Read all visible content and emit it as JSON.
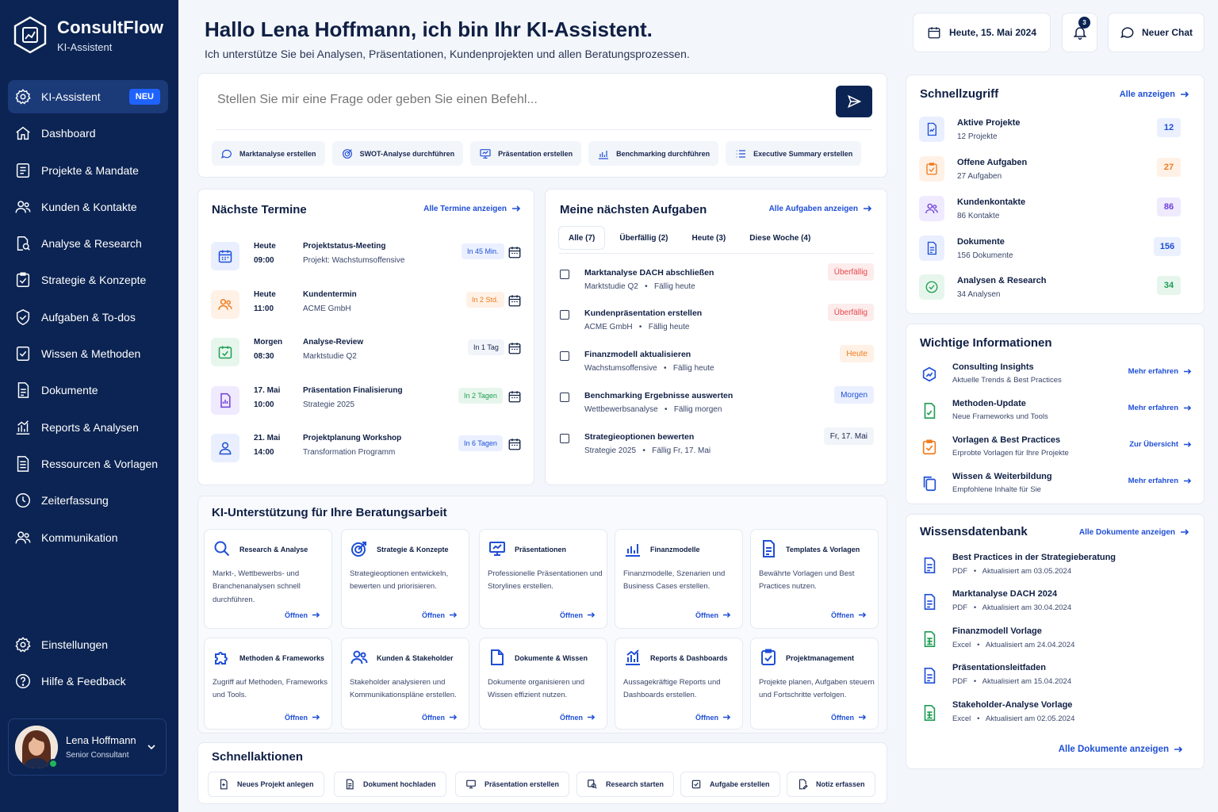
{
  "brand": {
    "name": "ConsultFlow",
    "subtitle": "KI-Assistent"
  },
  "nav": {
    "items": [
      {
        "label": "KI-Assistent",
        "badge": "NEU",
        "icon": "gear-icon"
      },
      {
        "label": "Dashboard",
        "icon": "home-icon"
      },
      {
        "label": "Projekte & Mandate",
        "icon": "folder-icon"
      },
      {
        "label": "Kunden & Kontakte",
        "icon": "users-icon"
      },
      {
        "label": "Analyse & Research",
        "icon": "search-icon"
      },
      {
        "label": "Strategie & Konzepte",
        "icon": "checklist-icon"
      },
      {
        "label": "Aufgaben & To-dos",
        "icon": "task-icon"
      },
      {
        "label": "Wissen & Methoden",
        "icon": "book-icon"
      },
      {
        "label": "Dokumente",
        "icon": "document-icon"
      },
      {
        "label": "Reports & Analysen",
        "icon": "chart-icon"
      },
      {
        "label": "Ressourcen & Vorlagen",
        "icon": "template-icon"
      },
      {
        "label": "Zeiterfassung",
        "icon": "clock-icon"
      },
      {
        "label": "Kommunikation",
        "icon": "chat-icon"
      }
    ],
    "bottom": [
      {
        "label": "Einstellungen",
        "icon": "gear-icon"
      },
      {
        "label": "Hilfe & Feedback",
        "icon": "help-icon"
      }
    ]
  },
  "user": {
    "name": "Lena Hoffmann",
    "role": "Senior Consultant"
  },
  "header": {
    "title": "Hallo Lena Hoffmann, ich bin Ihr KI-Assistent.",
    "subtitle": "Ich unterstütze Sie bei Analysen, Präsentationen, Kundenprojekten und allen Beratungsprozessen.",
    "date": "Heute, 15. Mai 2024",
    "notifications": "3",
    "new_chat": "Neuer Chat"
  },
  "chat": {
    "placeholder": "Stellen Sie mir eine Frage oder geben Sie einen Befehl...",
    "chips": [
      "Marktanalyse erstellen",
      "SWOT-Analyse durchführen",
      "Präsentation erstellen",
      "Benchmarking durchführen",
      "Executive Summary erstellen"
    ]
  },
  "appointments": {
    "title": "Nächste Termine",
    "link": "Alle Termine anzeigen",
    "items": [
      {
        "day": "Heute",
        "time": "09:00",
        "title": "Projektstatus-Meeting",
        "sub": "Projekt: Wachstumsoffensive",
        "badge": "In 45 Min."
      },
      {
        "day": "Heute",
        "time": "11:00",
        "title": "Kundentermin",
        "sub": "ACME GmbH",
        "badge": "In 2 Std."
      },
      {
        "day": "Morgen",
        "time": "08:30",
        "title": "Analyse-Review",
        "sub": "Marktstudie Q2",
        "badge": "In 1 Tag"
      },
      {
        "day": "17. Mai",
        "time": "10:00",
        "title": "Präsentation Finalisierung",
        "sub": "Strategie 2025",
        "badge": "In 2 Tagen"
      },
      {
        "day": "21. Mai",
        "time": "14:00",
        "title": "Projektplanung Workshop",
        "sub": "Transformation Programm",
        "badge": "In 6 Tagen"
      }
    ]
  },
  "tasks": {
    "title": "Meine nächsten Aufgaben",
    "link": "Alle Aufgaben anzeigen",
    "tabs": [
      "Alle (7)",
      "Überfällig (2)",
      "Heute (3)",
      "Diese Woche (4)"
    ],
    "items": [
      {
        "title": "Marktanalyse DACH abschließen",
        "project": "Marktstudie Q2",
        "due": "Fällig heute",
        "badge": "Überfällig"
      },
      {
        "title": "Kundenpräsentation erstellen",
        "project": "ACME GmbH",
        "due": "Fällig heute",
        "badge": "Überfällig"
      },
      {
        "title": "Finanzmodell aktualisieren",
        "project": "Wachstumsoffensive",
        "due": "Fällig heute",
        "badge": "Heute"
      },
      {
        "title": "Benchmarking Ergebnisse auswerten",
        "project": "Wettbewerbsanalyse",
        "due": "Fällig morgen",
        "badge": "Morgen"
      },
      {
        "title": "Strategieoptionen bewerten",
        "project": "Strategie 2025",
        "due": "Fällig Fr, 17. Mai",
        "badge": "Fr, 17. Mai"
      }
    ]
  },
  "support": {
    "title": "KI-Unterstützung für Ihre Beratungsarbeit",
    "open": "Öffnen",
    "tiles": [
      {
        "name": "Research & Analyse",
        "desc": "Markt-, Wettbewerbs- und Branchenanalysen schnell durchführen."
      },
      {
        "name": "Strategie & Konzepte",
        "desc": "Strategieoptionen entwickeln, bewerten und priorisieren."
      },
      {
        "name": "Präsentationen",
        "desc": "Professionelle Präsentationen und Storylines erstellen."
      },
      {
        "name": "Finanzmodelle",
        "desc": "Finanzmodelle, Szenarien und Business Cases erstellen."
      },
      {
        "name": "Templates & Vorlagen",
        "desc": "Bewährte Vorlagen und Best Practices nutzen."
      },
      {
        "name": "Methoden & Frameworks",
        "desc": "Zugriff auf Methoden, Frameworks und Tools."
      },
      {
        "name": "Kunden & Stakeholder",
        "desc": "Stakeholder analysieren und Kommunikationspläne erstellen."
      },
      {
        "name": "Dokumente & Wissen",
        "desc": "Dokumente organisieren und Wissen effizient nutzen."
      },
      {
        "name": "Reports & Dashboards",
        "desc": "Aussagekräftige Reports und Dashboards erstellen."
      },
      {
        "name": "Projektmanagement",
        "desc": "Projekte planen, Aufgaben steuern und Fortschritte verfolgen."
      }
    ]
  },
  "quick_actions": {
    "title": "Schnellaktionen",
    "items": [
      "Neues Projekt anlegen",
      "Dokument hochladen",
      "Präsentation erstellen",
      "Research starten",
      "Aufgabe erstellen",
      "Notiz erfassen"
    ]
  },
  "quick_access": {
    "title": "Schnellzugriff",
    "link": "Alle anzeigen",
    "items": [
      {
        "title": "Aktive Projekte",
        "sub": "12 Projekte",
        "count": "12"
      },
      {
        "title": "Offene Aufgaben",
        "sub": "27 Aufgaben",
        "count": "27"
      },
      {
        "title": "Kundenkontakte",
        "sub": "86 Kontakte",
        "count": "86"
      },
      {
        "title": "Dokumente",
        "sub": "156 Dokumente",
        "count": "156"
      },
      {
        "title": "Analysen & Research",
        "sub": "34 Analysen",
        "count": "34"
      }
    ]
  },
  "info": {
    "title": "Wichtige Informationen",
    "items": [
      {
        "title": "Consulting Insights",
        "sub": "Aktuelle Trends & Best Practices",
        "link": "Mehr erfahren"
      },
      {
        "title": "Methoden-Update",
        "sub": "Neue Frameworks und Tools",
        "link": "Mehr erfahren"
      },
      {
        "title": "Vorlagen & Best Practices",
        "sub": "Erprobte Vorlagen für Ihre Projekte",
        "link": "Zur Übersicht"
      },
      {
        "title": "Wissen & Weiterbildung",
        "sub": "Empfohlene Inhalte für Sie",
        "link": "Mehr erfahren"
      }
    ]
  },
  "knowledge": {
    "title": "Wissensdatenbank",
    "link": "Alle Dokumente anzeigen",
    "footer_link": "Alle Dokumente anzeigen",
    "items": [
      {
        "title": "Best Practices in der Strategieberatung",
        "type": "PDF",
        "updated": "Aktualisiert am 03.05.2024"
      },
      {
        "title": "Marktanalyse DACH 2024",
        "type": "PDF",
        "updated": "Aktualisiert am 30.04.2024"
      },
      {
        "title": "Finanzmodell Vorlage",
        "type": "Excel",
        "updated": "Aktualisiert am 24.04.2024"
      },
      {
        "title": "Präsentationsleitfaden",
        "type": "PDF",
        "updated": "Aktualisiert am 15.04.2024"
      },
      {
        "title": "Stakeholder-Analyse Vorlage",
        "type": "Excel",
        "updated": "Aktualisiert am 02.05.2024"
      }
    ]
  },
  "colors": {
    "navy": "#0c2453",
    "accent": "#1f4fd6",
    "red": "#e5484d",
    "orange": "#f07b1d",
    "green": "#1f9d55",
    "purple": "#6d3fd8"
  }
}
